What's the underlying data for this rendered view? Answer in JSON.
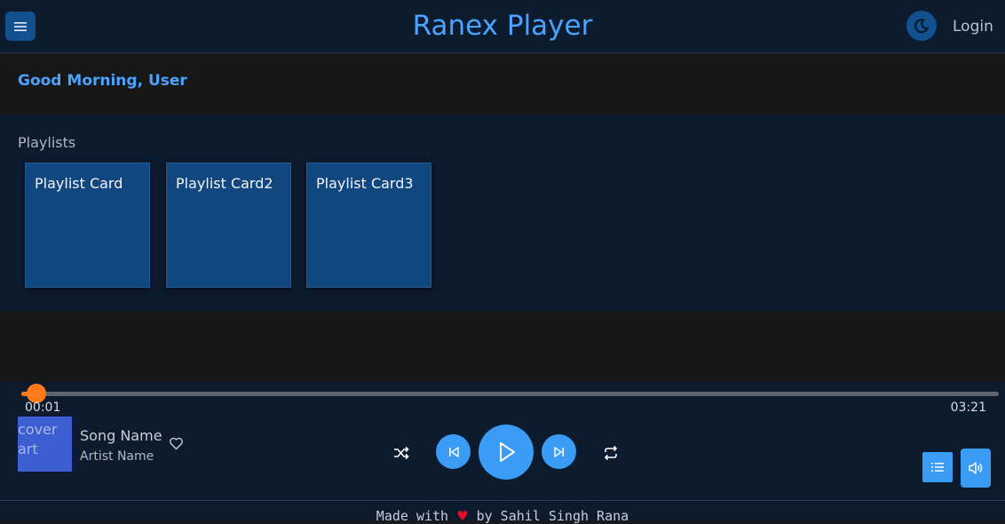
{
  "header": {
    "title": "Ranex Player",
    "login_label": "Login",
    "menu_icon": "hamburger-menu-icon",
    "theme_icon": "moon-icon"
  },
  "greeting": {
    "text": "Good Morning, User"
  },
  "playlists": {
    "title": "Playlists",
    "cards": [
      {
        "label": "Playlist Card"
      },
      {
        "label": "Playlist Card2"
      },
      {
        "label": "Playlist Card3"
      }
    ]
  },
  "player": {
    "current_time": "00:01",
    "total_time": "03:21",
    "progress_fraction": 0.015,
    "cover_alt": "cover art",
    "song_name": "Song Name",
    "artist_name": "Artist Name",
    "icons": [
      "heart-outline-icon",
      "shuffle-icon",
      "previous-icon",
      "play-icon",
      "next-icon",
      "repeat-icon",
      "queue-list-icon",
      "volume-icon"
    ]
  },
  "footer": {
    "prefix": "Made with ",
    "heart": "♥",
    "suffix": " by Sahil Singh Rana"
  },
  "colors": {
    "accent": "#3a9cf5",
    "title_blue": "#4aa3ff",
    "progress_orange": "#ff7a1a",
    "card_blue": "#12467f",
    "footer_heart": "#e0102a"
  }
}
